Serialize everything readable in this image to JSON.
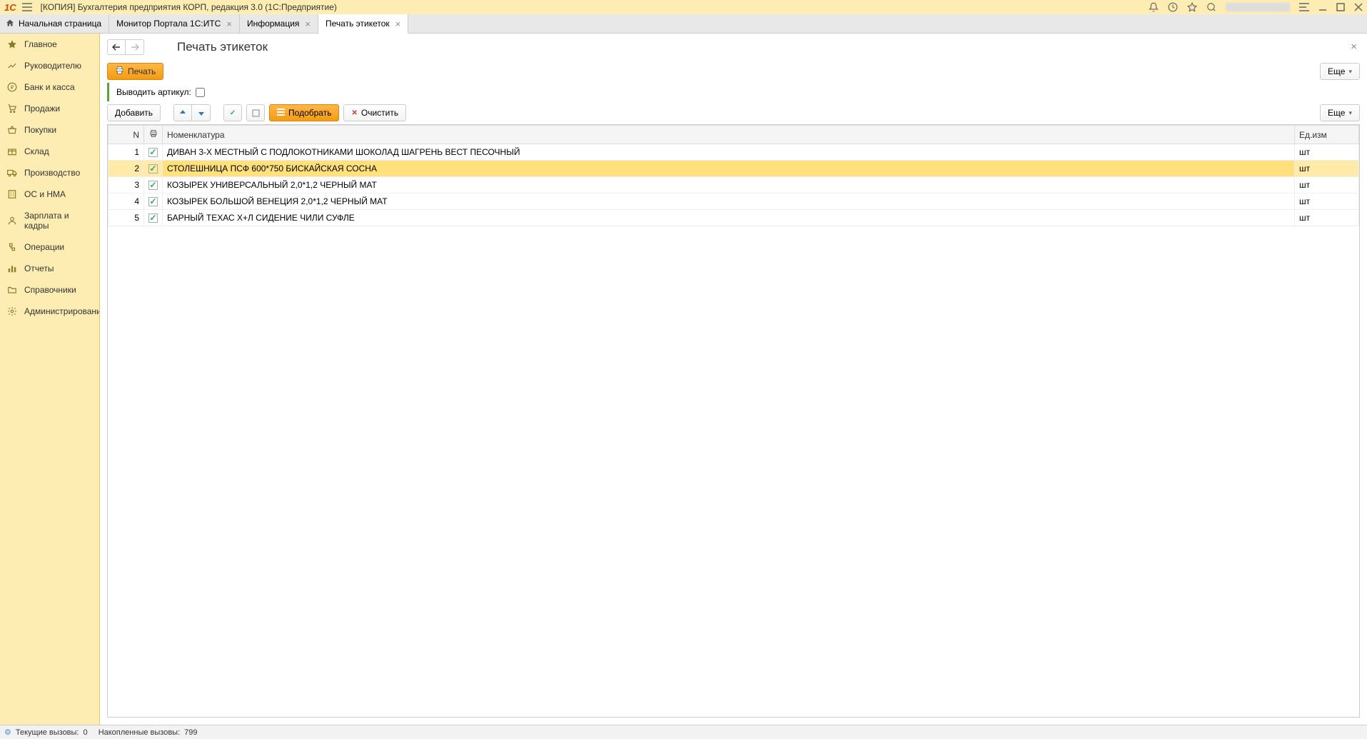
{
  "titlebar": {
    "logo": "1С",
    "app_title": "[КОПИЯ] Бухгалтерия предприятия КОРП, редакция 3.0  (1С:Предприятие)"
  },
  "tabs": {
    "home": "Начальная страница",
    "items": [
      {
        "label": "Монитор Портала 1С:ИТС",
        "active": false
      },
      {
        "label": "Информация",
        "active": false
      },
      {
        "label": "Печать этикеток",
        "active": true
      }
    ]
  },
  "sidebar": {
    "items": [
      {
        "icon": "star",
        "label": "Главное"
      },
      {
        "icon": "chart",
        "label": "Руководителю"
      },
      {
        "icon": "ruble",
        "label": "Банк и касса"
      },
      {
        "icon": "cart",
        "label": "Продажи"
      },
      {
        "icon": "basket",
        "label": "Покупки"
      },
      {
        "icon": "box",
        "label": "Склад"
      },
      {
        "icon": "truck",
        "label": "Производство"
      },
      {
        "icon": "building",
        "label": "ОС и НМА"
      },
      {
        "icon": "person",
        "label": "Зарплата и кадры"
      },
      {
        "icon": "ops",
        "label": "Операции"
      },
      {
        "icon": "bars",
        "label": "Отчеты"
      },
      {
        "icon": "folder",
        "label": "Справочники"
      },
      {
        "icon": "gear",
        "label": "Администрирование"
      }
    ]
  },
  "page": {
    "title": "Печать этикеток",
    "print_button": "Печать",
    "more_button": "Еще",
    "show_article_label": "Выводить артикул:",
    "add_button": "Добавить",
    "select_button": "Подобрать",
    "clear_button": "Очистить"
  },
  "table": {
    "headers": {
      "n": "N",
      "nomenclature": "Номенклатура",
      "unit": "Ед.изм"
    },
    "rows": [
      {
        "n": "1",
        "checked": true,
        "name": "ДИВАН 3-Х МЕСТНЫЙ С ПОДЛОКОТНИКАМИ ШОКОЛАД ШАГРЕНЬ ВЕСТ ПЕСОЧНЫЙ",
        "unit": "шт",
        "selected": false
      },
      {
        "n": "2",
        "checked": true,
        "name": "СТОЛЕШНИЦА ПСФ 600*750 БИСКАЙСКАЯ СОСНА",
        "unit": "шт",
        "selected": true
      },
      {
        "n": "3",
        "checked": true,
        "name": "КОЗЫРЕК УНИВЕРСАЛЬНЫЙ 2,0*1,2 ЧЕРНЫЙ МАТ",
        "unit": "шт",
        "selected": false
      },
      {
        "n": "4",
        "checked": true,
        "name": "КОЗЫРЕК БОЛЬШОЙ ВЕНЕЦИЯ 2,0*1,2 ЧЕРНЫЙ МАТ",
        "unit": "шт",
        "selected": false
      },
      {
        "n": "5",
        "checked": true,
        "name": "БАРНЫЙ ТЕХАС Х+Л СИДЕНИЕ ЧИЛИ СУФЛЕ",
        "unit": "шт",
        "selected": false
      }
    ]
  },
  "statusbar": {
    "current_calls_label": "Текущие вызовы:",
    "current_calls_value": "0",
    "accumulated_calls_label": "Накопленные вызовы:",
    "accumulated_calls_value": "799"
  }
}
